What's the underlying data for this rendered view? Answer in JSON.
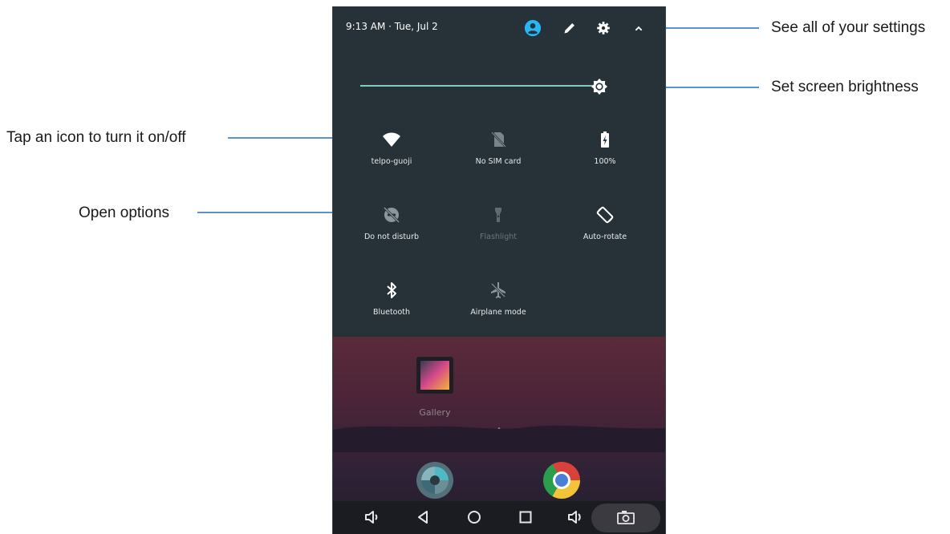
{
  "annotations": {
    "settings": "See all of your settings",
    "brightness": "Set screen brightness",
    "tap_icon": "Tap an icon to turn it on/off",
    "options": "Open options"
  },
  "status_bar": {
    "time_date": "9:13 AM · Tue, Jul 2"
  },
  "header_icons": [
    "account-icon",
    "edit-icon",
    "gear-icon",
    "chevron-up-icon"
  ],
  "brightness": {
    "level": 0.95
  },
  "tiles": [
    {
      "label": "telpo-guoji",
      "icon": "wifi-icon",
      "active": true
    },
    {
      "label": "No SIM card",
      "icon": "no-sim-icon",
      "active": true
    },
    {
      "label": "100%",
      "icon": "battery-icon",
      "active": true
    },
    {
      "label": "Do not disturb",
      "icon": "do-not-disturb-icon",
      "active": true
    },
    {
      "label": "Flashlight",
      "icon": "flashlight-icon",
      "active": false
    },
    {
      "label": "Auto-rotate",
      "icon": "auto-rotate-icon",
      "active": true
    },
    {
      "label": "Bluetooth",
      "icon": "bluetooth-icon",
      "active": true
    },
    {
      "label": "Airplane mode",
      "icon": "airplane-icon",
      "active": true
    }
  ],
  "home": {
    "gallery_label": "Gallery"
  },
  "colors": {
    "panel": "#263238",
    "accent": "#80cbc4",
    "account_icon": "#29b6f6",
    "annotation_line": "#5b93c9"
  }
}
